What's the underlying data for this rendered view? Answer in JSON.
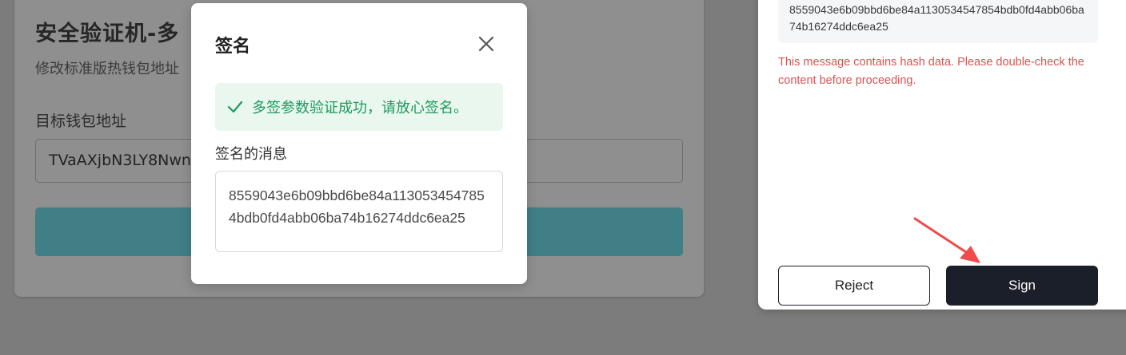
{
  "background_page": {
    "title": "安全验证机-多",
    "subtitle": "修改标准版热钱包地址",
    "field_label": "目标钱包地址",
    "field_value": "TVaAXjbN3LY8Nwn"
  },
  "sign_dialog": {
    "title": "签名",
    "close_icon": "close-icon",
    "success_message": "多签参数验证成功，请放心签名。",
    "message_label": "签名的消息",
    "message_value": "8559043e6b09bbd6be84a1130534547854bdb0fd4abb06ba74b16274ddc6ea25"
  },
  "wallet_popup": {
    "hash_value": "8559043e6b09bbd6be84a1130534547854bdb0fd4abb06ba74b16274ddc6ea25",
    "warning_text": "This message contains hash data. Please double-check the content before proceeding.",
    "reject_label": "Reject",
    "sign_label": "Sign"
  },
  "colors": {
    "success": "#1f9a5d",
    "warning": "#d9534f",
    "sign_button": "#1a1f29",
    "primary_button_bg": "#417f87",
    "annotation_arrow": "#f04a4a"
  }
}
